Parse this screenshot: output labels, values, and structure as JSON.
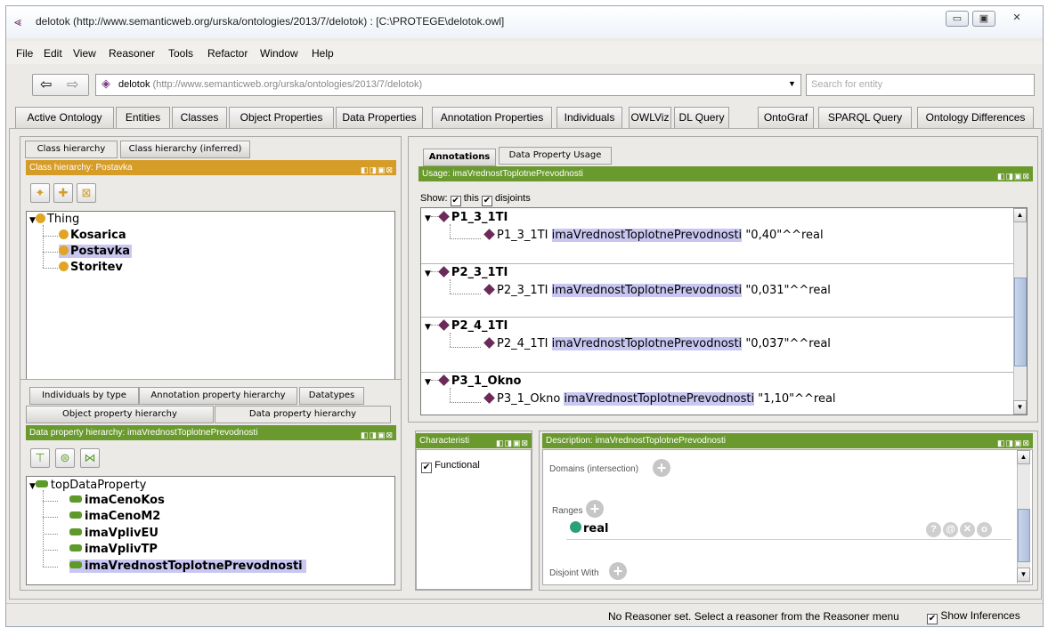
{
  "window": {
    "title": "delotok (http://www.semanticweb.org/urska/ontologies/2013/7/delotok)  : [C:\\PROTEGE\\delotok.owl]",
    "min_label": "▭",
    "max_label": "▣",
    "close_label": "✕"
  },
  "menu": [
    "File",
    "Edit",
    "View",
    "Reasoner",
    "Tools",
    "Refactor",
    "Window",
    "Help"
  ],
  "address": {
    "ontology_name": "delotok",
    "ontology_iri": "(http://www.semanticweb.org/urska/ontologies/2013/7/delotok)",
    "search_placeholder": "Search for entity"
  },
  "tabs": [
    "Active Ontology",
    "Entities",
    "Classes",
    "Object Properties",
    "Data Properties",
    "Annotation Properties",
    "Individuals",
    "OWLViz",
    "DL Query",
    "OntoGraf",
    "SPARQL Query",
    "Ontology Differences"
  ],
  "class_panel": {
    "tabs": [
      "Class hierarchy",
      "Class hierarchy (inferred)"
    ],
    "header": "Class hierarchy: Postavka",
    "root": "Thing",
    "children": [
      "Kosarica",
      "Postavka",
      "Storitev"
    ],
    "selected": "Postavka"
  },
  "property_panel": {
    "tabs_row1": [
      "Individuals by type",
      "Annotation property hierarchy",
      "Datatypes"
    ],
    "tabs_row2": [
      "Object property hierarchy",
      "Data property hierarchy"
    ],
    "header": "Data property hierarchy: imaVrednostToplotnePrevodnosti",
    "root": "topDataProperty",
    "children": [
      "imaCenoKos",
      "imaCenoM2",
      "imaVplivEU",
      "imaVplivTP",
      "imaVrednostToplotnePrevodnosti"
    ]
  },
  "usage_panel": {
    "tabs": [
      "Annotations",
      "Data Property Usage"
    ],
    "header": "Usage: imaVrednostToplotnePrevodnosti",
    "show_label": "Show:",
    "this_label": "this",
    "disjoints_label": "disjoints",
    "property": "imaVrednostToplotnePrevodnosti",
    "items": [
      {
        "name": "P1_3_1TI",
        "value": "\"0,40\"^^real"
      },
      {
        "name": "P2_3_1TI",
        "value": "\"0,031\"^^real"
      },
      {
        "name": "P2_4_1TI",
        "value": "\"0,037\"^^real"
      },
      {
        "name": "P3_1_Okno",
        "value": "\"1,10\"^^real"
      }
    ]
  },
  "characteristics_panel": {
    "header": "Characteristi",
    "functional_label": "Functional"
  },
  "description_panel": {
    "header": "Description: imaVrednostToplotnePrevodnosti",
    "domains_label": "Domains (intersection)",
    "ranges_label": "Ranges",
    "range_value": "real",
    "disjoint_label": "Disjoint With"
  },
  "status": {
    "reasoner_text": "No Reasoner set. Select a reasoner from the Reasoner menu",
    "show_inferences_label": "Show Inferences"
  }
}
